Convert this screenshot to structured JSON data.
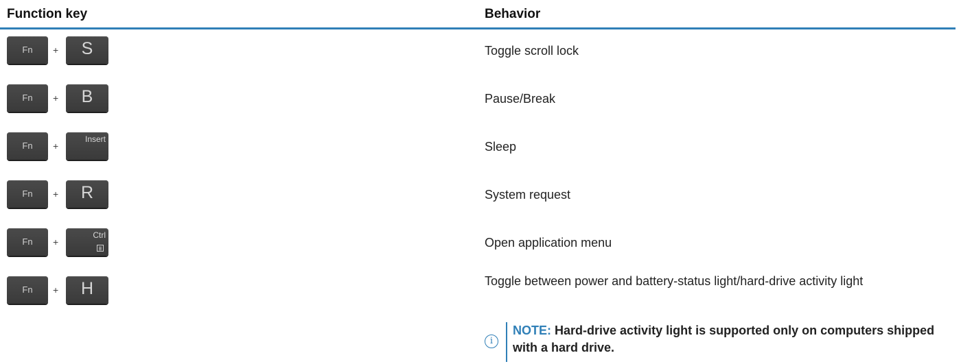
{
  "table": {
    "headers": [
      "Function key",
      "Behavior"
    ],
    "rows": [
      {
        "fn": "Fn",
        "plus": "+",
        "key": "S",
        "behavior": "Toggle scroll lock"
      },
      {
        "fn": "Fn",
        "plus": "+",
        "key": "B",
        "behavior": "Pause/Break"
      },
      {
        "fn": "Fn",
        "plus": "+",
        "key": "Insert",
        "behavior": "Sleep"
      },
      {
        "fn": "Fn",
        "plus": "+",
        "key": "R",
        "behavior": "System request"
      },
      {
        "fn": "Fn",
        "plus": "+",
        "key": "Ctrl",
        "behavior": "Open application menu"
      },
      {
        "fn": "Fn",
        "plus": "+",
        "key": "H",
        "behavior": "Toggle between power and battery-status light/hard-drive activity light"
      }
    ]
  },
  "note": {
    "label": "NOTE:",
    "text": "Hard-drive activity light is supported only on computers shipped with a hard drive.",
    "icon": "info-icon"
  },
  "colors": {
    "accent": "#2f7fb7",
    "key": "#404040"
  }
}
